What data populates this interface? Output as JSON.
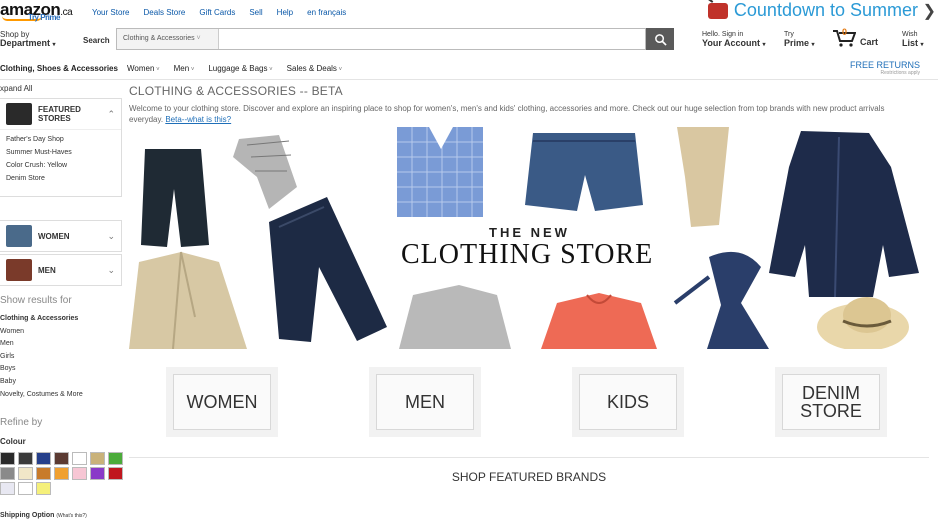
{
  "header": {
    "logo_text": "amazon",
    "logo_suffix": ".ca",
    "try_prime": "Try Prime",
    "links": [
      "Your Store",
      "Deals Store",
      "Gift Cards",
      "Sell",
      "Help",
      "en français"
    ],
    "promo": "Countdown to Summer"
  },
  "nav": {
    "shop_by": "Shop by",
    "department": "Department",
    "search_label": "Search",
    "search_category": "Clothing & Accessories",
    "search_placeholder": "",
    "hello": "Hello. Sign in",
    "your_account": "Your Account",
    "try": "Try",
    "prime": "Prime",
    "cart_count": "0",
    "cart": "Cart",
    "wish": "Wish",
    "list": "List"
  },
  "catbar": {
    "main": "Clothing, Shoes & Accessories",
    "items": [
      "Women",
      "Men",
      "Luggage & Bags",
      "Sales & Deals"
    ],
    "free_returns": "FREE RETURNS",
    "restrictions": "Restrictions apply"
  },
  "sidebar": {
    "expand_all": "xpand All",
    "featured_label": "FEATURED STORES",
    "featured_links": [
      "Father's Day Shop",
      "Summer Must-Haves",
      "Color Crush: Yellow",
      "Denim Store"
    ],
    "women_label": "WOMEN",
    "men_label": "MEN",
    "show_results": "Show results for",
    "results": [
      "Clothing & Accessories",
      "Women",
      "Men",
      "Girls",
      "Boys",
      "Baby",
      "Novelty, Costumes & More"
    ],
    "refine_by": "Refine by",
    "colour": "Colour",
    "swatches": [
      "#2a2a2a",
      "#3b3b3b",
      "#26408b",
      "#5b3a32",
      "#ffffff",
      "#c9b27a",
      "#4bab3a",
      "#8a8a8a",
      "#f1e7c8",
      "#c87b2a",
      "#f0a030",
      "#f7c6d4",
      "#8a3ac8",
      "#c0161e",
      "#e8e8f2",
      "#ffffff",
      "#f5f07a"
    ],
    "shipping_option": "Shipping Option",
    "whats_this": "(What's this?)"
  },
  "main": {
    "title": "CLOTHING & ACCESSORIES -- BETA",
    "welcome": "Welcome to your clothing store. Discover and explore an inspiring place to shop for women's, men's and kids' clothing, accessories and more. Check out our huge selection from top brands with new product arrivals everyday.",
    "beta_link": "Beta--what is this?",
    "hero_line1": "THE NEW",
    "hero_line2": "CLOTHING STORE",
    "categories": [
      "WOMEN",
      "MEN",
      "KIDS",
      "DENIM STORE"
    ],
    "brands_heading": "SHOP FEATURED BRANDS"
  }
}
